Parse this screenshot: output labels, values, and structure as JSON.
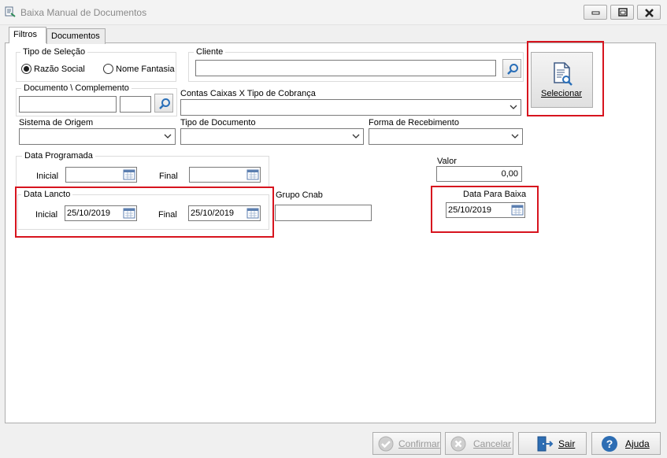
{
  "window": {
    "title": "Baixa Manual de Documentos"
  },
  "tabs": [
    {
      "label": "Filtros"
    },
    {
      "label": "Documentos"
    }
  ],
  "tipo_selecao": {
    "label": "Tipo de Seleção",
    "options": [
      {
        "label": "Razão Social",
        "selected": true
      },
      {
        "label": "Nome Fantasia",
        "selected": false
      }
    ]
  },
  "cliente": {
    "label": "Cliente",
    "value": ""
  },
  "documento": {
    "label": "Documento \\ Complemento",
    "value": "",
    "complemento": ""
  },
  "contas_caixas": {
    "label": "Contas Caixas X Tipo de Cobrança",
    "value": ""
  },
  "selecionar": {
    "label": "Selecionar"
  },
  "sistema_origem": {
    "label": "Sistema de Origem",
    "value": ""
  },
  "tipo_documento": {
    "label": "Tipo de Documento",
    "value": ""
  },
  "forma_recebimento": {
    "label": "Forma de Recebimento",
    "value": ""
  },
  "data_programada": {
    "label": "Data Programada",
    "inicial_label": "Inicial",
    "final_label": "Final",
    "inicial": "",
    "final": ""
  },
  "valor": {
    "label": "Valor",
    "value": "0,00"
  },
  "data_lancto": {
    "label": "Data Lancto",
    "inicial_label": "Inicial",
    "final_label": "Final",
    "inicial": "25/10/2019",
    "final": "25/10/2019"
  },
  "grupo_cnab": {
    "label": "Grupo Cnab",
    "value": ""
  },
  "data_para_baixa": {
    "label": "Data Para Baixa",
    "value": "25/10/2019"
  },
  "buttons": {
    "confirmar": "Confirmar",
    "cancelar": "Cancelar",
    "sair": "Sair",
    "ajuda": "Ajuda"
  },
  "colors": {
    "highlight": "#d7141e",
    "search_icon": "#2a6fb8"
  }
}
